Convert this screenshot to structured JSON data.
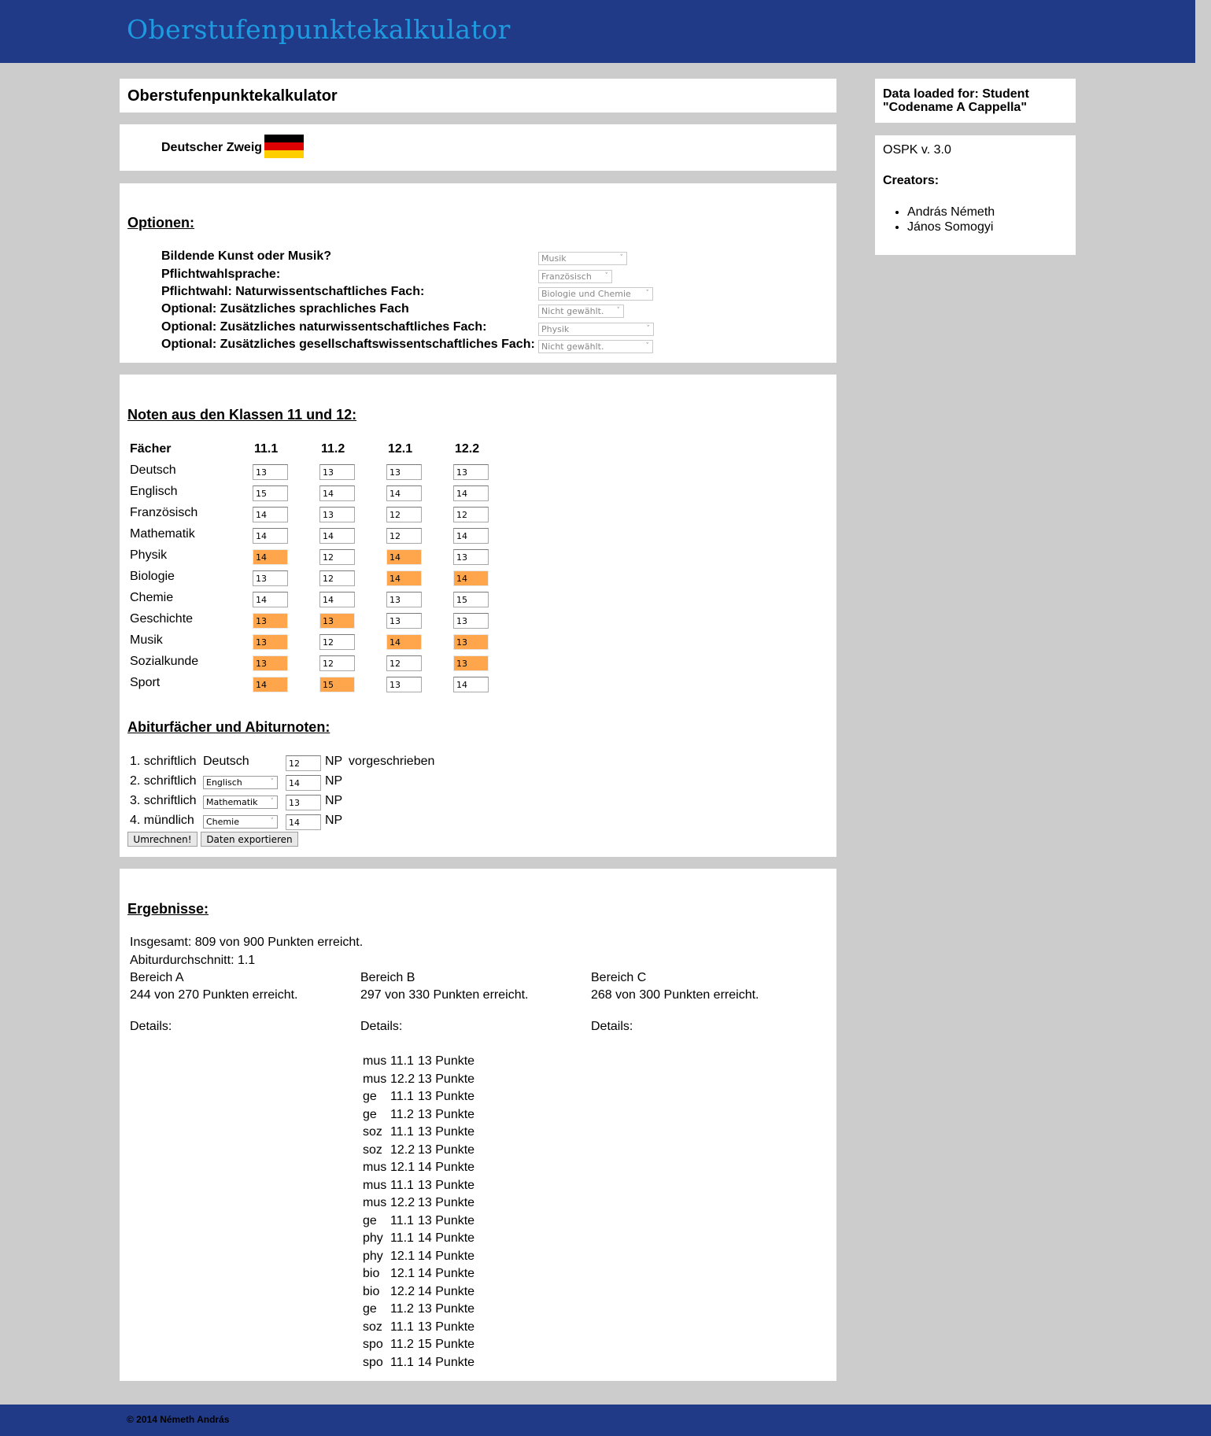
{
  "header": {
    "site_title": "Oberstufenpunktekalkulator"
  },
  "title_panel": {
    "heading": "Oberstufenpunktekalkulator"
  },
  "branch_panel": {
    "label": "Deutscher Zweig",
    "flag_colors": [
      "#000000",
      "#dd0000",
      "#ffce00"
    ]
  },
  "options": {
    "heading": "Optionen:",
    "rows": [
      {
        "label": "Bildende Kunst oder Musik?",
        "value": "Musik"
      },
      {
        "label": "Pflichtwahlsprache:",
        "value": "Französisch"
      },
      {
        "label": "Pflichtwahl: Naturwissentschaftliches Fach:",
        "value": "Biologie und Chemie"
      },
      {
        "label": "Optional: Zusätzliches sprachliches Fach",
        "value": "Nicht gewählt."
      },
      {
        "label": "Optional: Zusätzliches naturwissentschaftliches Fach:",
        "value": "Physik"
      },
      {
        "label": "Optional: Zusätzliches gesellschaftswissentschaftliches Fach:",
        "value": "Nicht gewählt."
      }
    ]
  },
  "grades": {
    "heading": "Noten aus den Klassen 11 und 12:",
    "columns": [
      "Fächer",
      "11.1",
      "11.2",
      "12.1",
      "12.2"
    ],
    "rows": [
      {
        "subject": "Deutsch",
        "values": [
          "13",
          "13",
          "13",
          "13"
        ],
        "highlight": [
          false,
          false,
          false,
          false
        ]
      },
      {
        "subject": "Englisch",
        "values": [
          "15",
          "14",
          "14",
          "14"
        ],
        "highlight": [
          false,
          false,
          false,
          false
        ]
      },
      {
        "subject": "Französisch",
        "values": [
          "14",
          "13",
          "12",
          "12"
        ],
        "highlight": [
          false,
          false,
          false,
          false
        ]
      },
      {
        "subject": "Mathematik",
        "values": [
          "14",
          "14",
          "12",
          "14"
        ],
        "highlight": [
          false,
          false,
          false,
          false
        ]
      },
      {
        "subject": "Physik",
        "values": [
          "14",
          "12",
          "14",
          "13"
        ],
        "highlight": [
          true,
          false,
          true,
          false
        ]
      },
      {
        "subject": "Biologie",
        "values": [
          "13",
          "12",
          "14",
          "14"
        ],
        "highlight": [
          false,
          false,
          true,
          true
        ]
      },
      {
        "subject": "Chemie",
        "values": [
          "14",
          "14",
          "13",
          "15"
        ],
        "highlight": [
          false,
          false,
          false,
          false
        ]
      },
      {
        "subject": "Geschichte",
        "values": [
          "13",
          "13",
          "13",
          "13"
        ],
        "highlight": [
          true,
          true,
          false,
          false
        ]
      },
      {
        "subject": "Musik",
        "values": [
          "13",
          "12",
          "14",
          "13"
        ],
        "highlight": [
          true,
          false,
          true,
          true
        ]
      },
      {
        "subject": "Sozialkunde",
        "values": [
          "13",
          "12",
          "12",
          "13"
        ],
        "highlight": [
          true,
          false,
          false,
          true
        ]
      },
      {
        "subject": "Sport",
        "values": [
          "14",
          "15",
          "13",
          "14"
        ],
        "highlight": [
          true,
          true,
          false,
          false
        ]
      }
    ],
    "highlight_color": "#ffa64d"
  },
  "abitur": {
    "heading": "Abiturfächer und Abiturnoten:",
    "rows": [
      {
        "label": "1. schriftlich",
        "subject": "Deutsch",
        "is_select": false,
        "grade": "12",
        "unit": "NP",
        "note": "vorgeschrieben"
      },
      {
        "label": "2. schriftlich",
        "subject": "Englisch",
        "is_select": true,
        "grade": "14",
        "unit": "NP",
        "note": ""
      },
      {
        "label": "3. schriftlich",
        "subject": "Mathematik",
        "is_select": true,
        "grade": "13",
        "unit": "NP",
        "note": ""
      },
      {
        "label": "4. mündlich",
        "subject": "Chemie",
        "is_select": true,
        "grade": "14",
        "unit": "NP",
        "note": ""
      }
    ],
    "buttons": {
      "convert": "Umrechnen!",
      "export": "Daten exportieren"
    }
  },
  "results": {
    "heading": "Ergebnisse:",
    "total": "Insgesamt: 809 von 900 Punkten erreicht.",
    "average": "Abiturdurchschnitt: 1.1",
    "areas": [
      {
        "name": "Bereich A",
        "score": "244 von 270 Punkten erreicht.",
        "details_label": "Details:",
        "details": []
      },
      {
        "name": "Bereich B",
        "score": "297 von 330 Punkten erreicht.",
        "details_label": "Details:",
        "details": [
          [
            "mus",
            "11.1",
            "13 Punkte"
          ],
          [
            "mus",
            "12.2",
            "13 Punkte"
          ],
          [
            "ge",
            "11.1",
            "13 Punkte"
          ],
          [
            "ge",
            "11.2",
            "13 Punkte"
          ],
          [
            "soz",
            "11.1",
            "13 Punkte"
          ],
          [
            "soz",
            "12.2",
            "13 Punkte"
          ],
          [
            "mus",
            "12.1",
            "14 Punkte"
          ],
          [
            "mus",
            "11.1",
            "13 Punkte"
          ],
          [
            "mus",
            "12.2",
            "13 Punkte"
          ],
          [
            "ge",
            "11.1",
            "13 Punkte"
          ],
          [
            "phy",
            "11.1",
            "14 Punkte"
          ],
          [
            "phy",
            "12.1",
            "14 Punkte"
          ],
          [
            "bio",
            "12.1",
            "14 Punkte"
          ],
          [
            "bio",
            "12.2",
            "14 Punkte"
          ],
          [
            "ge",
            "11.2",
            "13 Punkte"
          ],
          [
            "soz",
            "11.1",
            "13 Punkte"
          ],
          [
            "spo",
            "11.2",
            "15 Punkte"
          ],
          [
            "spo",
            "11.1",
            "14 Punkte"
          ]
        ]
      },
      {
        "name": "Bereich C",
        "score": "268 von 300 Punkten erreicht.",
        "details_label": "Details:",
        "details": []
      }
    ]
  },
  "sidebar": {
    "loaded_text": "Data loaded for: Student \"Codename A Cappella\"",
    "version": "OSPK v. 3.0",
    "creators_label": "Creators:",
    "creators": [
      "András Németh",
      "János Somogyi"
    ]
  },
  "footer": {
    "copyright": "© 2014 Németh András"
  }
}
